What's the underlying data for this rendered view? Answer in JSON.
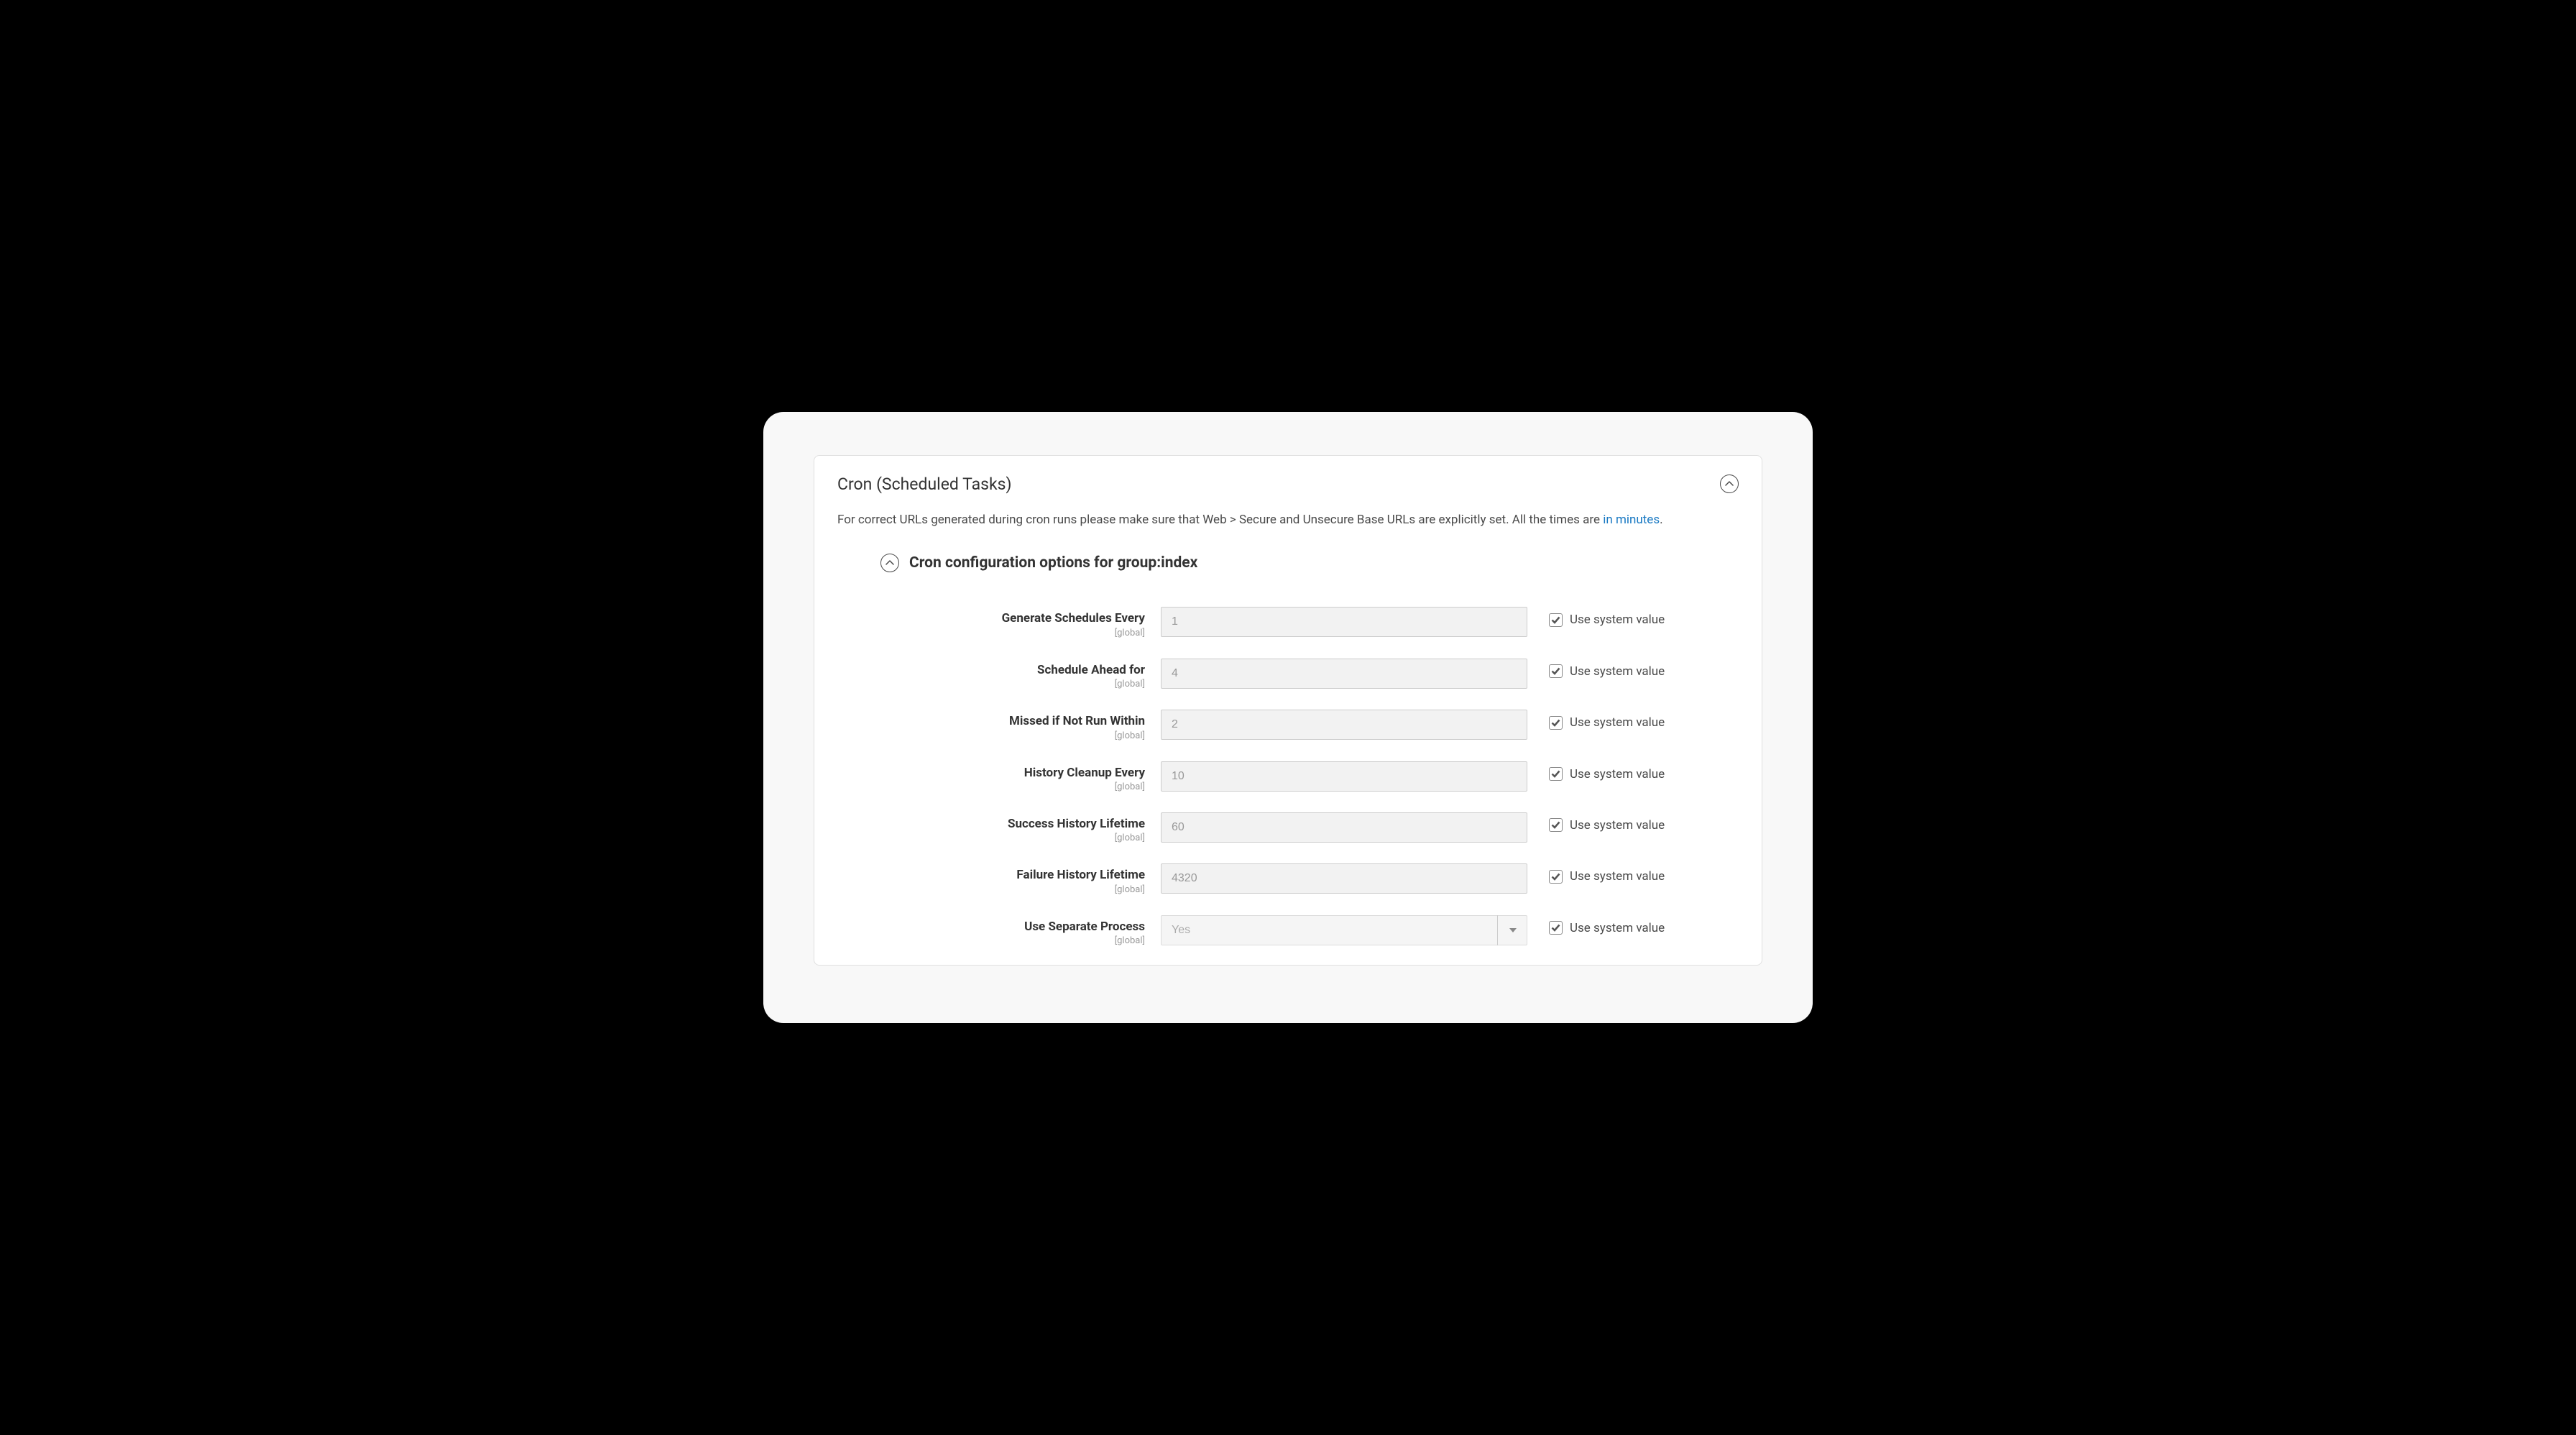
{
  "panel": {
    "title": "Cron (Scheduled Tasks)",
    "description_prefix": "For correct URLs generated during cron runs please make sure that Web > Secure and Unsecure Base URLs are explicitly set. All the times are ",
    "description_link": "in minutes",
    "description_suffix": "."
  },
  "group": {
    "title": "Cron configuration options for group:index"
  },
  "fields": {
    "generate_schedules": {
      "label": "Generate Schedules Every",
      "scope": "[global]",
      "value": "1"
    },
    "schedule_ahead": {
      "label": "Schedule Ahead for",
      "scope": "[global]",
      "value": "4"
    },
    "missed_if": {
      "label": "Missed if Not Run Within",
      "scope": "[global]",
      "value": "2"
    },
    "history_cleanup": {
      "label": "History Cleanup Every",
      "scope": "[global]",
      "value": "10"
    },
    "success_lifetime": {
      "label": "Success History Lifetime",
      "scope": "[global]",
      "value": "60"
    },
    "failure_lifetime": {
      "label": "Failure History Lifetime",
      "scope": "[global]",
      "value": "4320"
    },
    "separate_process": {
      "label": "Use Separate Process",
      "scope": "[global]",
      "value": "Yes"
    }
  },
  "checkbox_label": "Use system value"
}
